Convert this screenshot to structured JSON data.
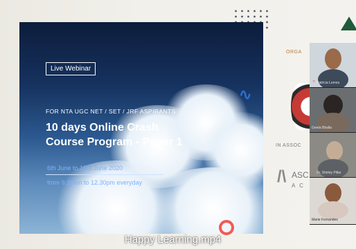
{
  "slide": {
    "badge": "Live Webinar",
    "tagline": "FOR NTA UGC NET / SET / JRF ASPIRANTS",
    "title_line1": "10 days Online Crash",
    "title_line2": "Course  Program - Paper 1",
    "dates": "6th June to 15th June 2020",
    "time": "from 9.30am to 12.30pm everyday"
  },
  "caption": "Happy Learning.mp4",
  "right_area": {
    "org_text": "ORGA",
    "assoc_text": "IN ASSOC",
    "asc_text": "ASC",
    "ac_text": "A  C"
  },
  "participants": [
    {
      "name": "Patricia Lemos"
    },
    {
      "name": "Geeta Bhalla"
    },
    {
      "name": "Dr. Shirley Pillai"
    },
    {
      "name": "Marie Fernandes"
    }
  ]
}
